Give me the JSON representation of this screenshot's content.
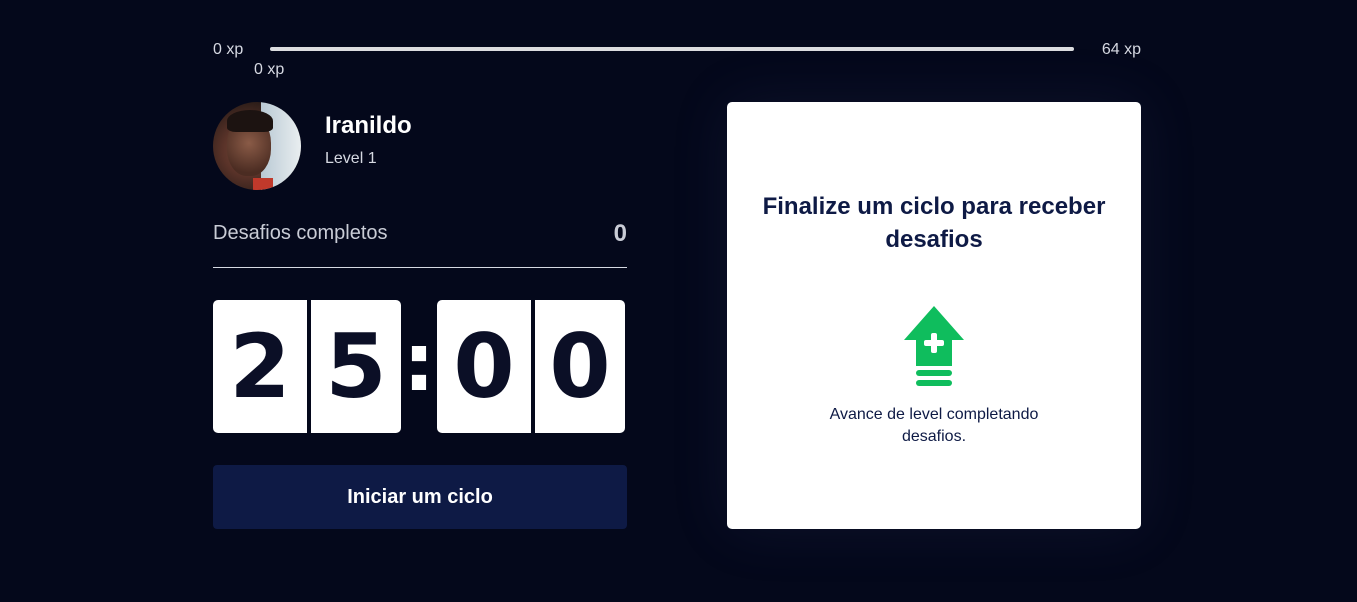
{
  "xp": {
    "min_label": "0 xp",
    "max_label": "64 xp",
    "current_label": "0 xp",
    "progress": 0
  },
  "profile": {
    "name": "Iranildo",
    "level_label": "Level 1"
  },
  "challenges": {
    "label": "Desafios completos",
    "count": "0"
  },
  "countdown": {
    "minute_left": "2",
    "minute_right": "5",
    "separator": ":",
    "second_left": "0",
    "second_right": "0"
  },
  "start_button": {
    "label": "Iniciar um ciclo"
  },
  "challenge_card": {
    "title": "Finalize um ciclo para receber desafios",
    "icon": "level-up-icon",
    "description": "Avance de level completando desafios."
  },
  "colors": {
    "background": "#04081b",
    "button": "#0e1a45",
    "accent_green": "#0fbd5d",
    "card": "#ffffff"
  }
}
